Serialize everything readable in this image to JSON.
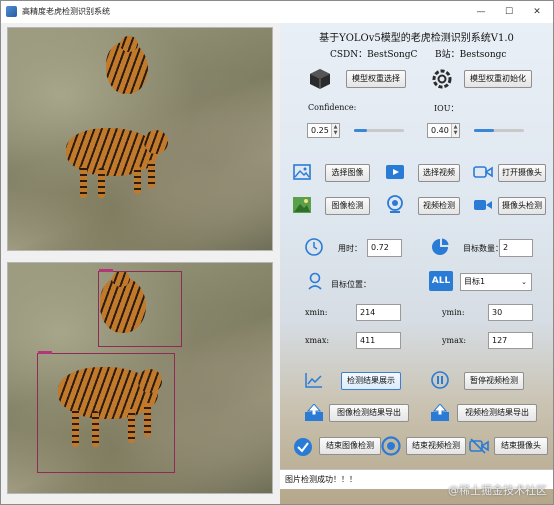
{
  "window": {
    "title": "高精度老虎检测识别系统",
    "minimize": "—",
    "maximize": "☐",
    "close": "✕"
  },
  "header": {
    "title": "基于YOLOv5模型的老虎检测识别系统V1.0",
    "csdn": "CSDN：BestSongC",
    "bilibili": "B站：Bestsongc"
  },
  "model": {
    "select_label": "模型权重选择",
    "init_label": "模型权重初始化"
  },
  "params": {
    "confidence_label": "Confidence:",
    "confidence_value": "0.25",
    "confidence_level": 0.25,
    "iou_label": "IOU：",
    "iou_value": "0.40",
    "iou_level": 0.4
  },
  "sources": {
    "select_image": "选择图像",
    "select_video": "选择视频",
    "open_camera": "打开摄像头"
  },
  "detect": {
    "image_detect": "图像检测",
    "video_detect": "视频检测",
    "camera_detect": "摄像头检测"
  },
  "result": {
    "time_label": "用时：",
    "time_value": "0.72",
    "count_label": "目标数量：",
    "count_value": "2",
    "position_label": "目标位置：",
    "target_select": "目标1",
    "xmin_label": "xmin:",
    "xmin_value": "214",
    "ymin_label": "ymin:",
    "ymin_value": "30",
    "xmax_label": "xmax:",
    "xmax_value": "411",
    "ymax_label": "ymax:",
    "ymax_value": "127"
  },
  "actions": {
    "show_result": "检测结果展示",
    "pause_video": "暂停视频检测",
    "export_image": "图像检测结果导出",
    "export_video": "视频检测结果导出",
    "end_image": "结束图像检测",
    "end_video": "结束视频检测",
    "end_camera": "结束摄像头"
  },
  "status": {
    "message": "图片检测成功！！！"
  },
  "watermark": "@稀土掘金技术社区",
  "colors": {
    "accent": "#3a86d9",
    "bbox": "#8e2b57",
    "icon_blue": "#2a7bd6"
  }
}
